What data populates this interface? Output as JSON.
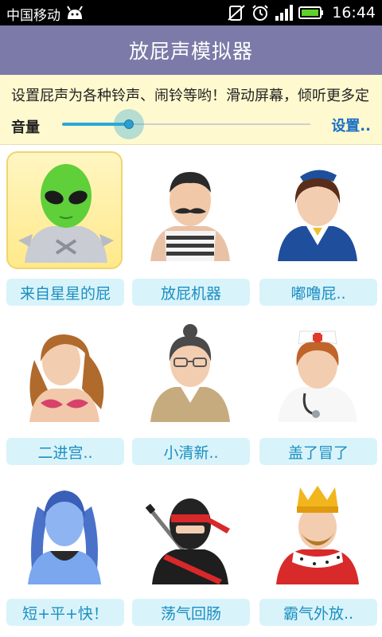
{
  "status_bar": {
    "carrier": "中国移动",
    "time": "16:44",
    "icons": [
      "android-icon",
      "mute-icon",
      "alarm-icon",
      "signal-icon",
      "battery-icon"
    ]
  },
  "app": {
    "title": "放屁声模拟器"
  },
  "settings": {
    "marquee": "设置屁声为各种铃声、闹铃等哟！滑动屏幕，倾听更多定",
    "volume_label": "音量",
    "volume_level": 0.27,
    "settings_link": "设置..",
    "accent": "#2aa8d8"
  },
  "sounds": [
    {
      "label": "来自星星的屁",
      "icon": "alien-icon",
      "selected": true
    },
    {
      "label": "放屁机器",
      "icon": "mustache-man-icon",
      "selected": false
    },
    {
      "label": "嘟噜屁..",
      "icon": "flight-attendant-icon",
      "selected": false
    },
    {
      "label": "二进宫..",
      "icon": "mermaid-woman-icon",
      "selected": false
    },
    {
      "label": "小清新..",
      "icon": "glasses-woman-icon",
      "selected": false
    },
    {
      "label": "盖了冒了",
      "icon": "nurse-icon",
      "selected": false
    },
    {
      "label": "短+平+快！",
      "icon": "avatar-woman-icon",
      "selected": false
    },
    {
      "label": "荡气回肠",
      "icon": "ninja-icon",
      "selected": false
    },
    {
      "label": "霸气外放..",
      "icon": "king-icon",
      "selected": false
    }
  ]
}
